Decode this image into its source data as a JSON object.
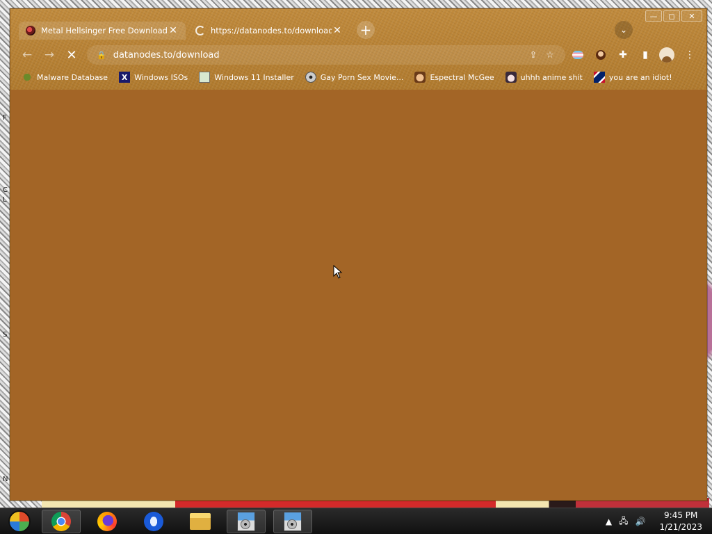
{
  "desktop": {
    "side_letters": [
      "F",
      "C",
      "L",
      "S",
      "N"
    ]
  },
  "window": {
    "controls": {
      "minimize": "—",
      "maximize": "◻",
      "close": "✕"
    }
  },
  "tabs": [
    {
      "title": "Metal Hellsinger Free Download (",
      "close": "✕"
    },
    {
      "title": "https://datanodes.to/download",
      "close": "✕"
    }
  ],
  "new_tab_label": "+",
  "tab_search_label": "⌄",
  "toolbar": {
    "back": "←",
    "forward": "→",
    "stop": "✕",
    "lock": "🔒",
    "url": "datanodes.to/download",
    "share": "⇪",
    "star": "☆",
    "extensions": "✚",
    "sidepanel": "▮",
    "menu": "⋮"
  },
  "bookmarks": [
    {
      "label": "Malware Database",
      "icon": "bug-icon"
    },
    {
      "label": "Windows ISOs",
      "icon": "x-icon",
      "glyph": "X"
    },
    {
      "label": "Windows 11 Installer",
      "icon": "installer-icon"
    },
    {
      "label": "Gay Porn Sex Movie...",
      "icon": "cd-icon"
    },
    {
      "label": "Espectral McGee",
      "icon": "face-icon"
    },
    {
      "label": "uhhh anime shit",
      "icon": "anime-icon"
    },
    {
      "label": "you are an idiot!",
      "icon": "flag-icon"
    }
  ],
  "taskbar": {
    "apps": [
      "start",
      "chrome",
      "firefox",
      "opera",
      "file-explorer",
      "installer-1",
      "installer-2"
    ],
    "tray": {
      "arrow": "▲",
      "network": "🖧",
      "volume": "🔊"
    },
    "time": "9:45 PM",
    "date": "1/21/2023"
  },
  "colors": {
    "page_background": "#a36526",
    "chrome_frame": "#b98236"
  }
}
